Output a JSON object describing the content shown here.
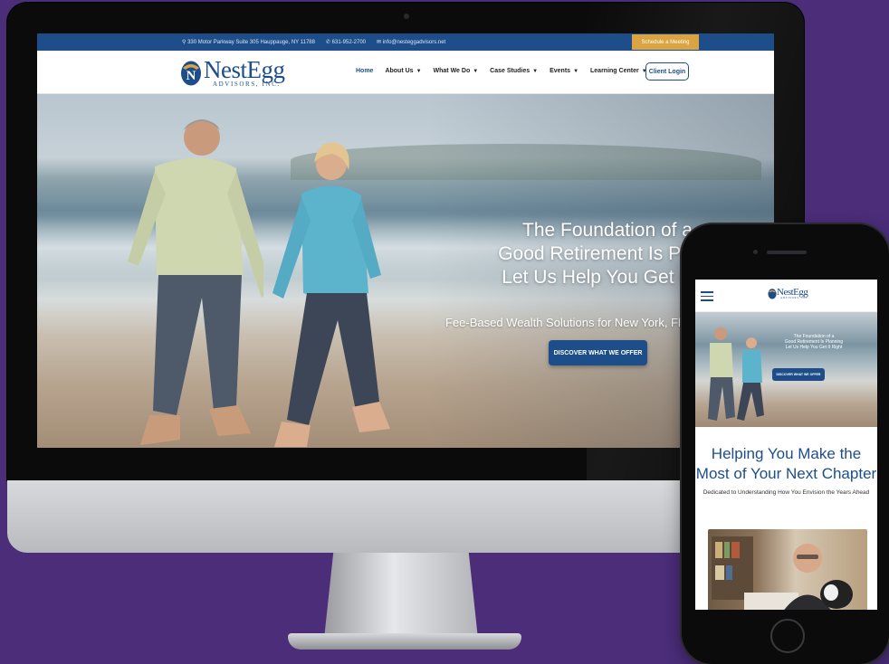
{
  "desktop": {
    "topbar": {
      "address": "330 Motor Parkway Suite 305 Hauppauge, NY 11788",
      "phone": "631-952-2700",
      "email": "info@nesteggadvisors.net",
      "schedule_label": "Schedule a Meeting"
    },
    "logo": {
      "name": "NestEgg",
      "tagline": "ADVISORS, INC."
    },
    "nav": {
      "items": [
        {
          "label": "Home",
          "dropdown": false
        },
        {
          "label": "About Us",
          "dropdown": true
        },
        {
          "label": "What We Do",
          "dropdown": true
        },
        {
          "label": "Case Studies",
          "dropdown": true
        },
        {
          "label": "Events",
          "dropdown": true
        },
        {
          "label": "Learning Center",
          "dropdown": true
        }
      ],
      "client_login": "Client Login"
    },
    "hero": {
      "heading_line1": "The Foundation of a",
      "heading_line2": "Good Retirement Is Plann",
      "heading_line3": "Let Us Help You Get It Ri",
      "subheading": "Fee-Based Wealth Solutions for New York, Flori",
      "cta": "DISCOVER WHAT WE OFFER"
    }
  },
  "mobile": {
    "logo": {
      "name": "NestEgg",
      "tagline": "ADVISORS, INC."
    },
    "hero": {
      "heading_line1": "The Foundation of a",
      "heading_line2": "Good Retirement Is Planning",
      "heading_line3": "Let Us Help You Get It Right",
      "cta": "DISCOVER WHAT WE OFFER"
    },
    "section_heading": "Helping You Make the Most of Your Next Chapter",
    "section_sub": "Dedicated to Understanding How You Envision the Years Ahead"
  },
  "colors": {
    "brand_blue": "#1d4e8a",
    "accent_gold": "#d9a441",
    "background_purple": "#4b2d7a"
  }
}
